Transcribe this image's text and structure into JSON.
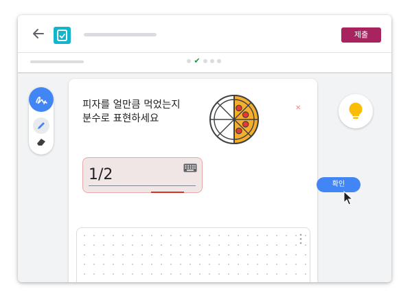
{
  "header": {
    "submit_label": "제출"
  },
  "progress": {
    "steps": [
      "dot",
      "check",
      "dot",
      "dot",
      "dot"
    ],
    "current": 1
  },
  "toolbar": {
    "tools": [
      "handwriting-tool",
      "pen-tool",
      "eraser-tool"
    ],
    "active": "handwriting-tool"
  },
  "question": {
    "line1": "피자를 얼만큼 먹었는지",
    "line2": "분수로 표현하세요"
  },
  "pizza": {
    "slices_total": 8,
    "slices_eaten": 4
  },
  "answer": {
    "value": "1/2"
  },
  "actions": {
    "check_label": "확인"
  },
  "colors": {
    "accent_blue": "#4285f4",
    "submit_magenta": "#a8245f",
    "logo_teal": "#12b5cb",
    "hint_yellow": "#fbbc04",
    "error_red": "#d93025",
    "check_green": "#1e8e3e",
    "pizza_orange": "#f6ae2d",
    "pepperoni_red": "#e53935"
  }
}
